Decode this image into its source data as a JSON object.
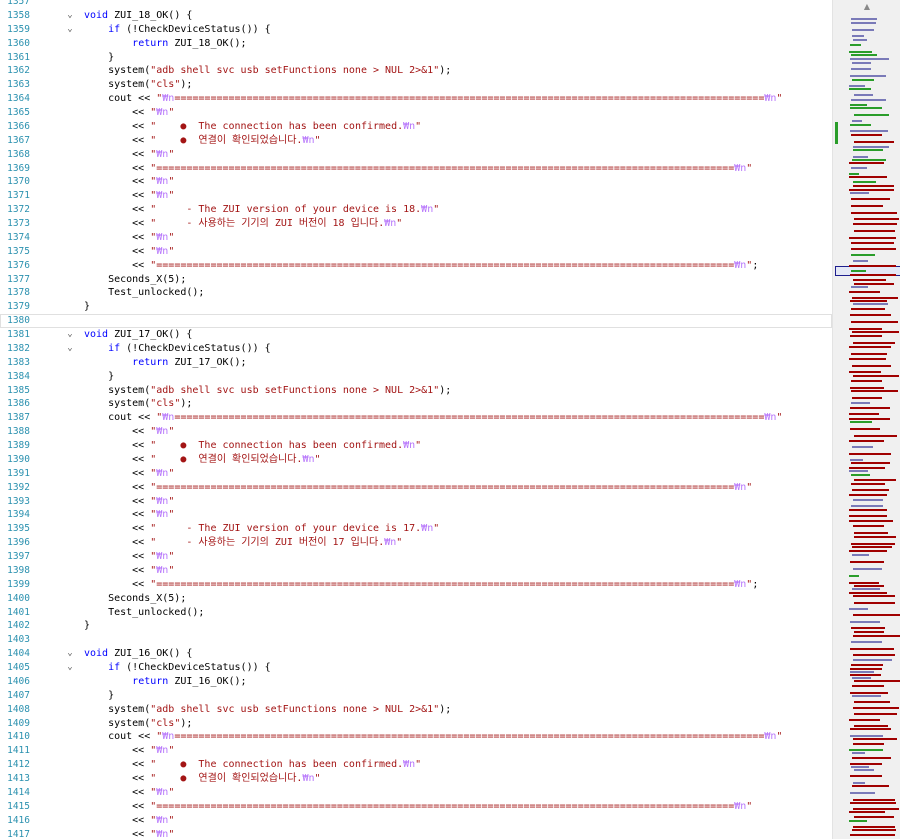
{
  "editor": {
    "current_line": 1380,
    "lines": [
      {
        "n": "1357",
        "text": ""
      },
      {
        "n": "1358",
        "text": "void ZUI_18_OK() {"
      },
      {
        "n": "1359",
        "text": "    if (!CheckDeviceStatus()) {"
      },
      {
        "n": "1360",
        "text": "        return ZUI_18_OK();"
      },
      {
        "n": "1361",
        "text": "    }"
      },
      {
        "n": "1362",
        "text": "    system(\"adb shell svc usb setFunctions none > NUL 2>&1\");"
      },
      {
        "n": "1363",
        "text": "    system(\"cls\");"
      },
      {
        "n": "1364",
        "text": "    cout << \"₩n==================================================================================================₩n\""
      },
      {
        "n": "1365",
        "text": "        << \"₩n\""
      },
      {
        "n": "1366",
        "text": "        << \"    ●  The connection has been confirmed.₩n\""
      },
      {
        "n": "1367",
        "text": "        << \"    ●  연결이 확인되었습니다.₩n\""
      },
      {
        "n": "1368",
        "text": "        << \"₩n\""
      },
      {
        "n": "1369",
        "text": "        << \"================================================================================================₩n\""
      },
      {
        "n": "1370",
        "text": "        << \"₩n\""
      },
      {
        "n": "1371",
        "text": "        << \"₩n\""
      },
      {
        "n": "1372",
        "text": "        << \"     - The ZUI version of your device is 18.₩n\""
      },
      {
        "n": "1373",
        "text": "        << \"     - 사용하는 기기의 ZUI 버전이 18 입니다.₩n\""
      },
      {
        "n": "1374",
        "text": "        << \"₩n\""
      },
      {
        "n": "1375",
        "text": "        << \"₩n\""
      },
      {
        "n": "1376",
        "text": "        << \"================================================================================================₩n\";"
      },
      {
        "n": "1377",
        "text": "    Seconds_X(5);"
      },
      {
        "n": "1378",
        "text": "    Test_unlocked();"
      },
      {
        "n": "1379",
        "text": "}"
      },
      {
        "n": "1380",
        "text": ""
      },
      {
        "n": "1381",
        "text": "void ZUI_17_OK() {"
      },
      {
        "n": "1382",
        "text": "    if (!CheckDeviceStatus()) {"
      },
      {
        "n": "1383",
        "text": "        return ZUI_17_OK();"
      },
      {
        "n": "1384",
        "text": "    }"
      },
      {
        "n": "1385",
        "text": "    system(\"adb shell svc usb setFunctions none > NUL 2>&1\");"
      },
      {
        "n": "1386",
        "text": "    system(\"cls\");"
      },
      {
        "n": "1387",
        "text": "    cout << \"₩n==================================================================================================₩n\""
      },
      {
        "n": "1388",
        "text": "        << \"₩n\""
      },
      {
        "n": "1389",
        "text": "        << \"    ●  The connection has been confirmed.₩n\""
      },
      {
        "n": "1390",
        "text": "        << \"    ●  연결이 확인되었습니다.₩n\""
      },
      {
        "n": "1391",
        "text": "        << \"₩n\""
      },
      {
        "n": "1392",
        "text": "        << \"================================================================================================₩n\""
      },
      {
        "n": "1393",
        "text": "        << \"₩n\""
      },
      {
        "n": "1394",
        "text": "        << \"₩n\""
      },
      {
        "n": "1395",
        "text": "        << \"     - The ZUI version of your device is 17.₩n\""
      },
      {
        "n": "1396",
        "text": "        << \"     - 사용하는 기기의 ZUI 버전이 17 입니다.₩n\""
      },
      {
        "n": "1397",
        "text": "        << \"₩n\""
      },
      {
        "n": "1398",
        "text": "        << \"₩n\""
      },
      {
        "n": "1399",
        "text": "        << \"================================================================================================₩n\";"
      },
      {
        "n": "1400",
        "text": "    Seconds_X(5);"
      },
      {
        "n": "1401",
        "text": "    Test_unlocked();"
      },
      {
        "n": "1402",
        "text": "}"
      },
      {
        "n": "1403",
        "text": ""
      },
      {
        "n": "1404",
        "text": "void ZUI_16_OK() {"
      },
      {
        "n": "1405",
        "text": "    if (!CheckDeviceStatus()) {"
      },
      {
        "n": "1406",
        "text": "        return ZUI_16_OK();"
      },
      {
        "n": "1407",
        "text": "    }"
      },
      {
        "n": "1408",
        "text": "    system(\"adb shell svc usb setFunctions none > NUL 2>&1\");"
      },
      {
        "n": "1409",
        "text": "    system(\"cls\");"
      },
      {
        "n": "1410",
        "text": "    cout << \"₩n==================================================================================================₩n\""
      },
      {
        "n": "1411",
        "text": "        << \"₩n\""
      },
      {
        "n": "1412",
        "text": "        << \"    ●  The connection has been confirmed.₩n\""
      },
      {
        "n": "1413",
        "text": "        << \"    ●  연결이 확인되었습니다.₩n\""
      },
      {
        "n": "1414",
        "text": "        << \"₩n\""
      },
      {
        "n": "1415",
        "text": "        << \"================================================================================================₩n\""
      },
      {
        "n": "1416",
        "text": "        << \"₩n\""
      },
      {
        "n": "1417",
        "text": "        << \"₩n\""
      }
    ]
  },
  "scrollbar": {
    "up_arrow_icon": "triangle-up-icon"
  },
  "colors": {
    "line_number": "#2b91af",
    "keyword": "#0000ff",
    "string": "#a31515",
    "escape": "#b776fb",
    "minimap_error": "#a00000",
    "minimap_change": "#2a9d2a"
  }
}
